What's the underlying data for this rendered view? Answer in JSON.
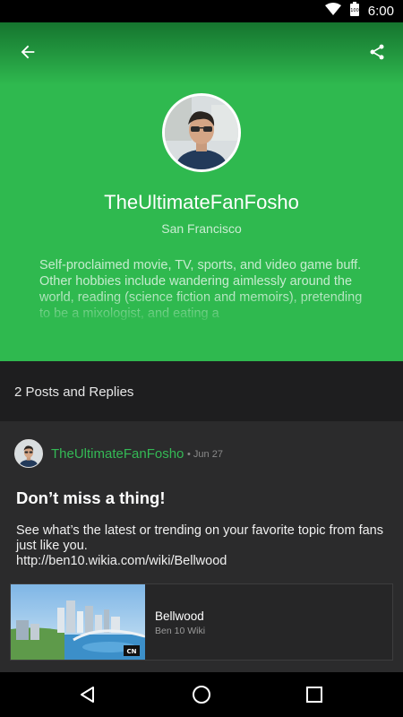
{
  "status_bar": {
    "time": "6:00",
    "icons": [
      "wifi-icon",
      "battery-icon"
    ]
  },
  "toolbar": {
    "back_icon": "arrow-back-icon",
    "share_icon": "share-icon"
  },
  "profile": {
    "username": "TheUltimateFanFosho",
    "location": "San Francisco",
    "bio": "Self-proclaimed movie, TV, sports, and video game buff. Other hobbies include wandering aimlessly around the world, reading (science fiction and memoirs), pretending to be a mixologist, and eating a",
    "accent_color": "#2fb94f"
  },
  "posts_summary": {
    "label": "2 Posts and Replies"
  },
  "post": {
    "author": "TheUltimateFanFosho",
    "date": "• Jun 27",
    "title": "Don’t miss a thing!",
    "body": "See what’s the latest or trending on your favorite topic from fans just like you.",
    "link": "http://ben10.wikia.com/wiki/Bellwood",
    "preview": {
      "title": "Bellwood",
      "subtitle": "Ben 10 Wiki",
      "badge": "CN"
    }
  },
  "nav_bar": {
    "buttons": [
      "back-triangle-icon",
      "home-circle-icon",
      "recents-square-icon"
    ]
  }
}
